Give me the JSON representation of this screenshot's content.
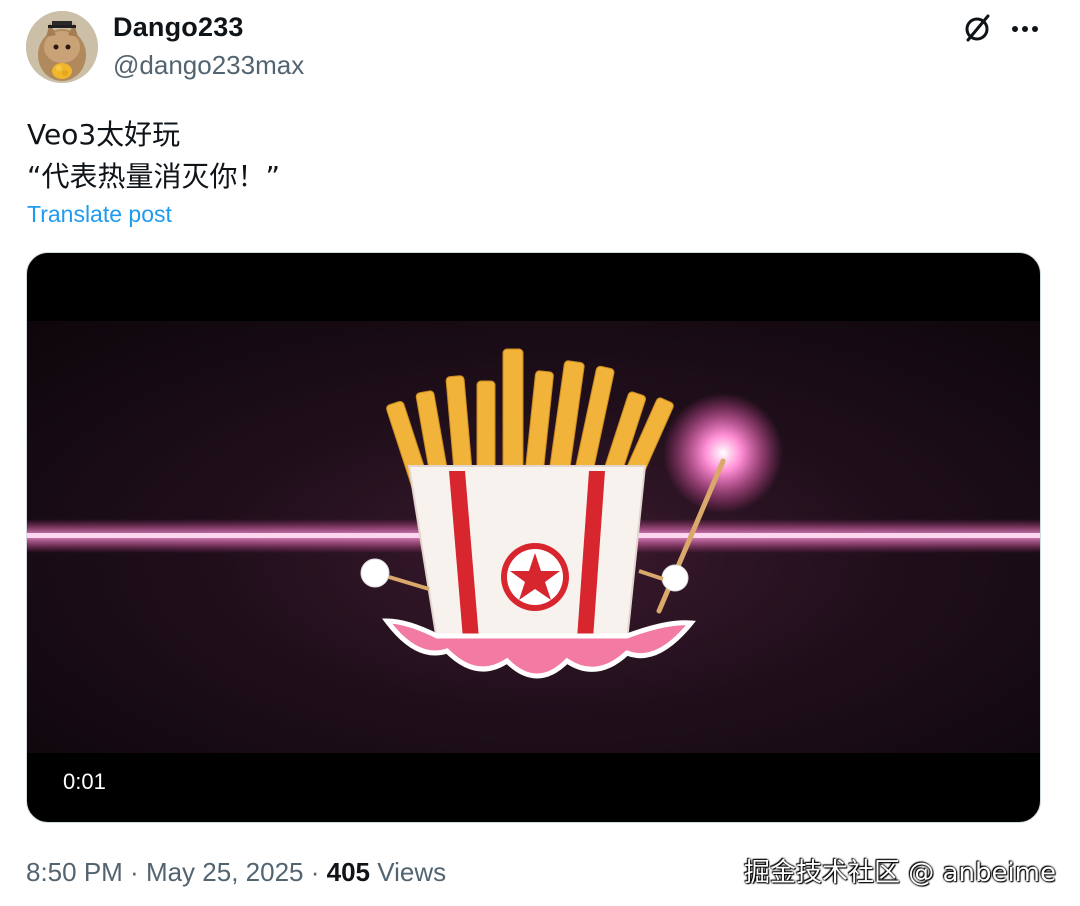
{
  "author": {
    "display_name": "Dango233",
    "handle": "@dango233max",
    "avatar_icon": "cat-avatar"
  },
  "header_actions": {
    "grok_icon": "grok-icon",
    "more_icon": "more-icon"
  },
  "post": {
    "line1": "Veo3太好玩",
    "line2": "“代表热量消灭你！”",
    "translate_label": "Translate post"
  },
  "media": {
    "type": "video",
    "timestamp": "0:01"
  },
  "meta": {
    "time": "8:50 PM",
    "separator1": " · ",
    "date": "May 25, 2025",
    "separator2": " · ",
    "views_count": "405",
    "views_label": " Views"
  },
  "watermark": "掘金技术社区 @ anbeime",
  "colors": {
    "link": "#1d9bf0",
    "secondary_text": "#536471",
    "primary_text": "#0f1419",
    "accent_pink": "#ff4fb3"
  }
}
